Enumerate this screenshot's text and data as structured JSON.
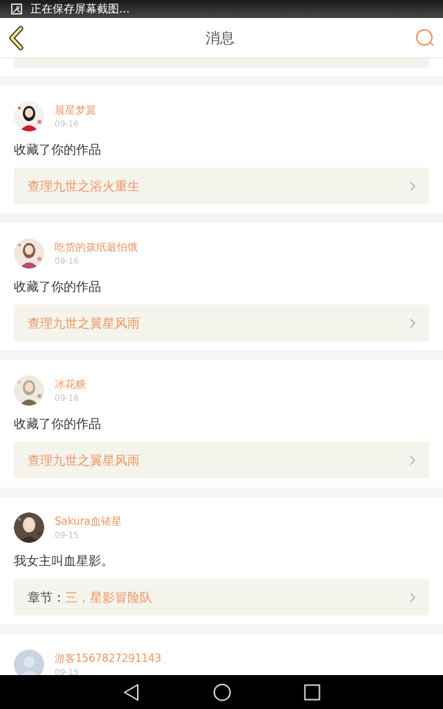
{
  "status_bar": {
    "notification": "正在保存屏幕截图..."
  },
  "header": {
    "title": "消息"
  },
  "messages": [
    {
      "name": "晨星梦翼",
      "date": "09-16",
      "text": "收藏了你的作品",
      "link": {
        "title": "查理九世之浴火重生"
      }
    },
    {
      "name": "吃货的孩纸最怕饿",
      "date": "09-16",
      "text": "收藏了你的作品",
      "link": {
        "title": "查理九世之翼星风雨"
      }
    },
    {
      "name": "冰花糖",
      "date": "09-16",
      "text": "收藏了你的作品",
      "link": {
        "title": "查理九世之翼星风雨"
      }
    },
    {
      "name": "Sakura血铱星",
      "date": "09-15",
      "text": "我女主叫血星影。",
      "link": {
        "label": "章节：",
        "title": "三，星影冒险队"
      }
    },
    {
      "avatar": {
        "kind": "default"
      },
      "name": "游客1567827291143",
      "date": "09-15"
    }
  ]
}
